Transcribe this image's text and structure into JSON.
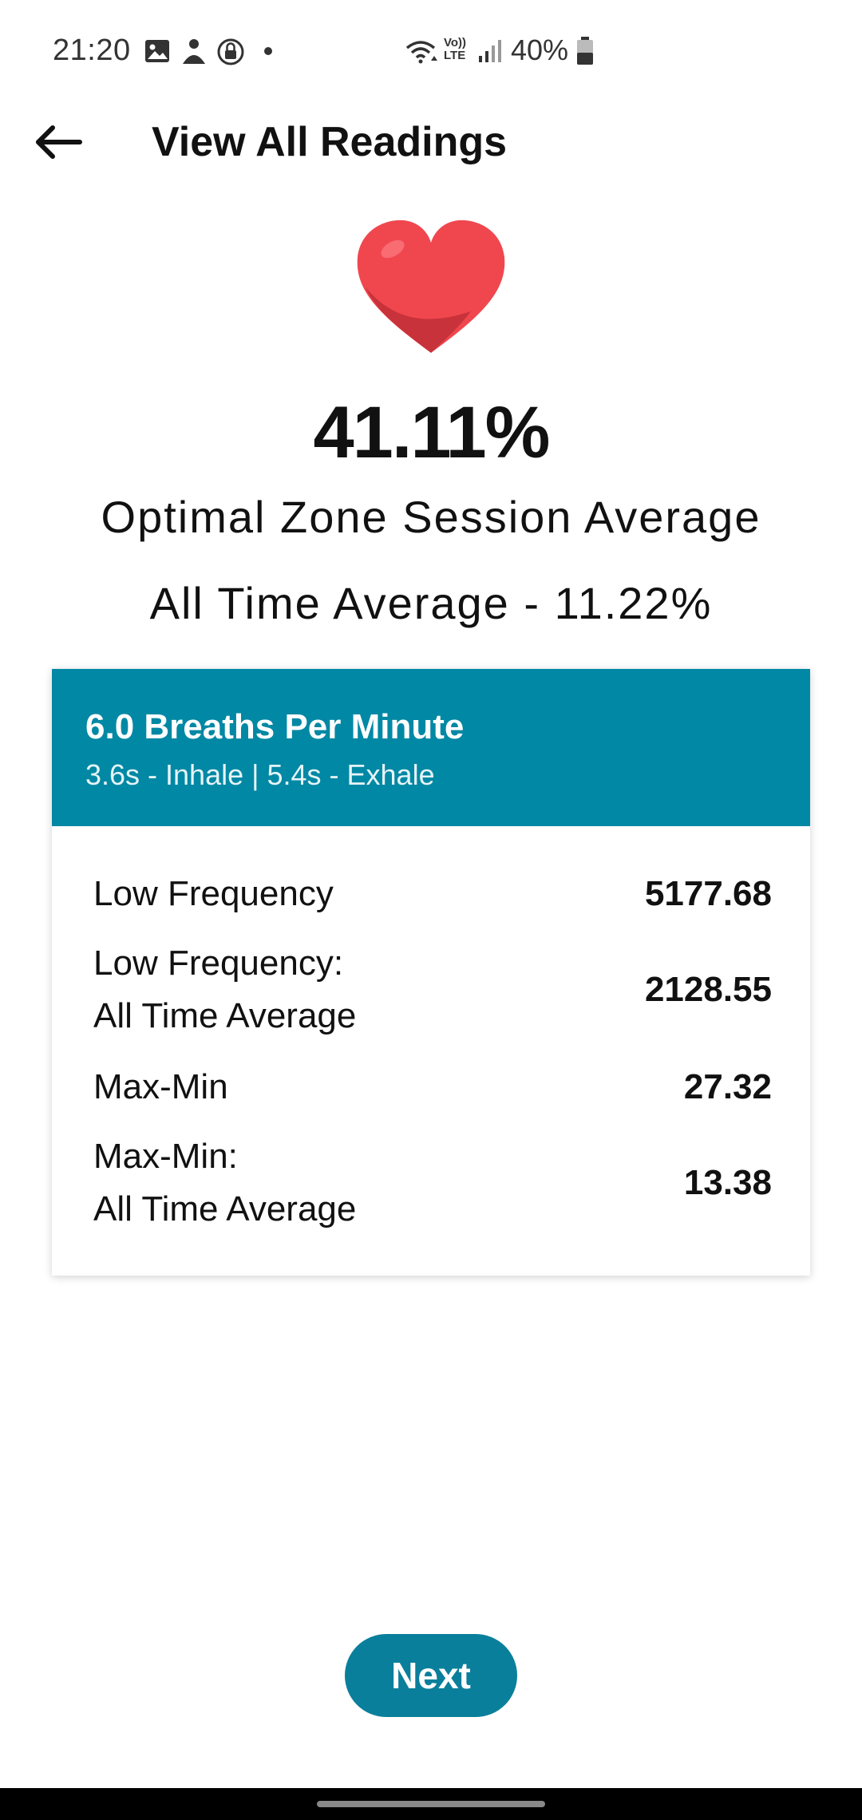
{
  "status_bar": {
    "time": "21:20",
    "right_text": "40%",
    "icons": [
      "image-icon",
      "user-icon",
      "lock-icon",
      "dot-icon",
      "wifi-icon",
      "volte-icon",
      "signal-icon",
      "battery-icon"
    ],
    "volte_label_top": "Vo))",
    "volte_label_bottom": "LTE"
  },
  "app_bar": {
    "title": "View All Readings"
  },
  "summary": {
    "value": "41.11%",
    "label": "Optimal Zone Session Average",
    "all_time": "All Time Average - 11.22%"
  },
  "card": {
    "title": "6.0 Breaths Per Minute",
    "subtitle": "3.6s - Inhale | 5.4s - Exhale",
    "rows": [
      {
        "label_line1": "Low Frequency",
        "label_line2": "",
        "value": "5177.68"
      },
      {
        "label_line1": "Low Frequency:",
        "label_line2": "All Time Average",
        "value": "2128.55"
      },
      {
        "label_line1": "Max-Min",
        "label_line2": "",
        "value": "27.32"
      },
      {
        "label_line1": "Max-Min:",
        "label_line2": "All Time Average",
        "value": "13.38"
      }
    ]
  },
  "next_button": {
    "label": "Next"
  },
  "colors": {
    "accent": "#0188a4",
    "button": "#0a7f9b",
    "heart": "#f0474f"
  }
}
